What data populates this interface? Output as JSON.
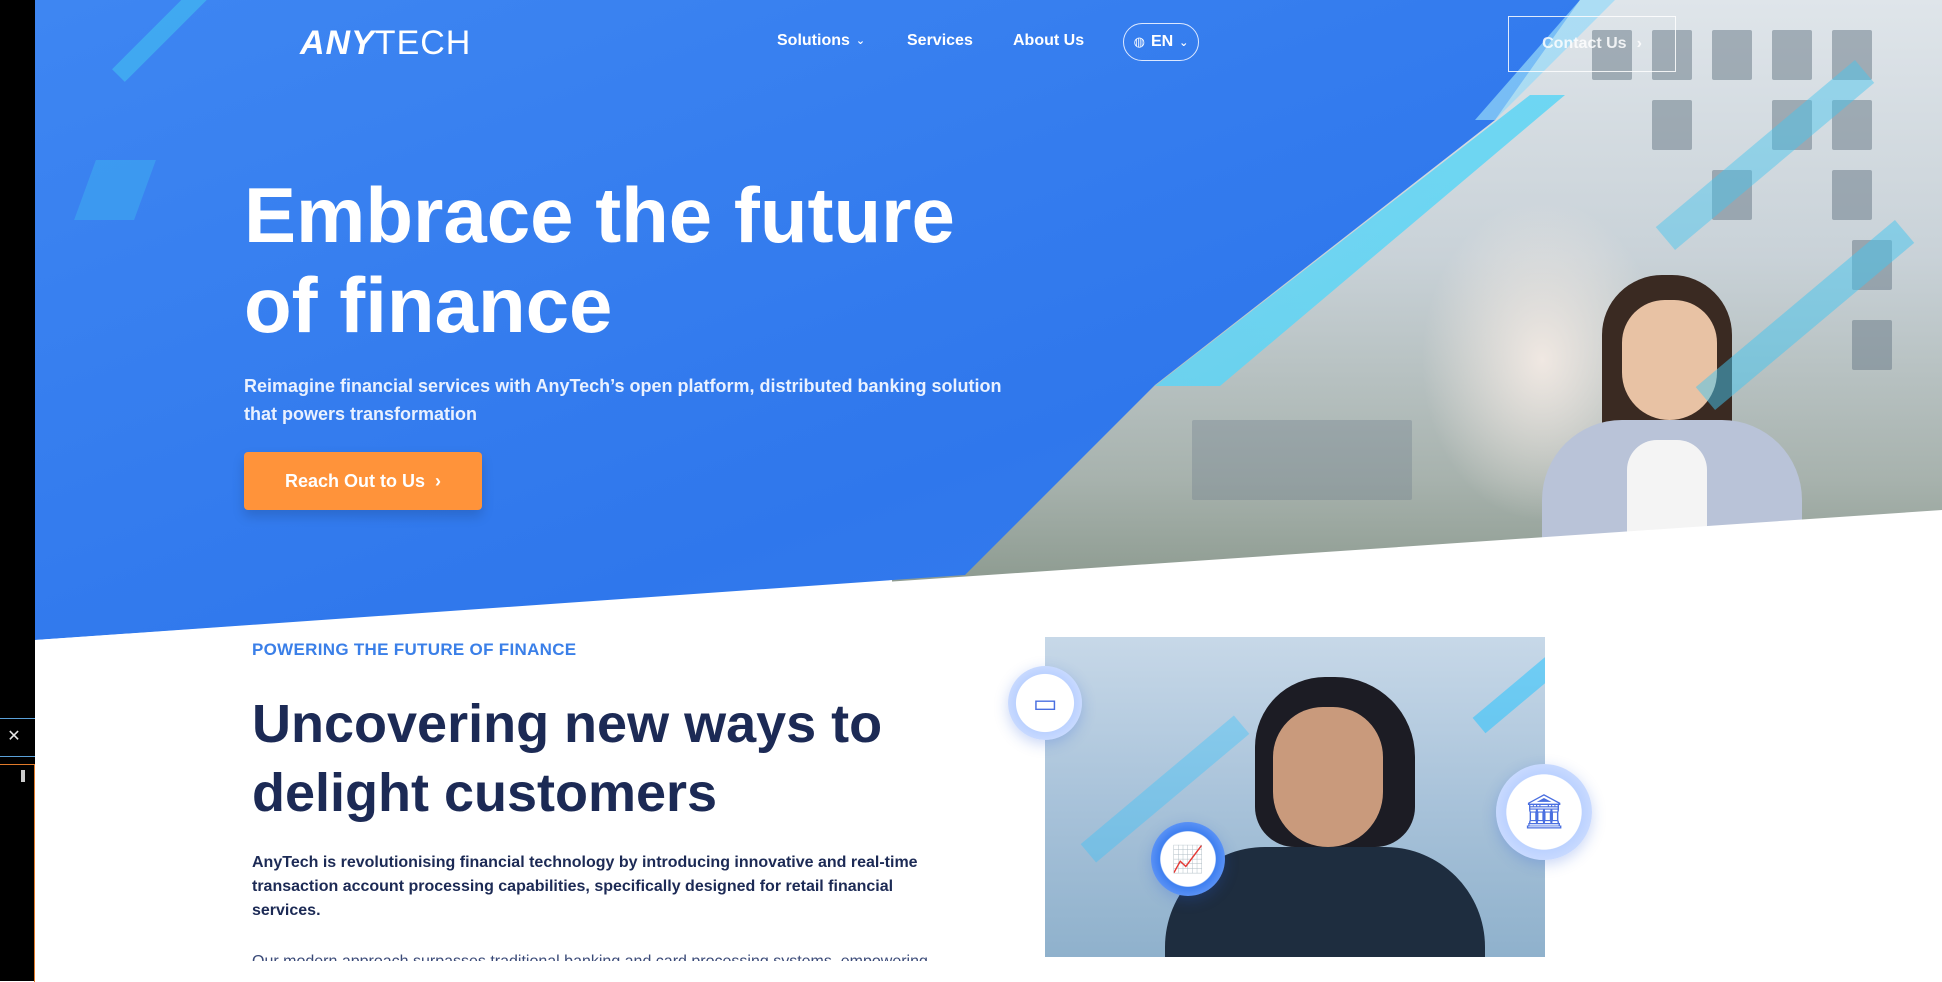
{
  "header": {
    "logo_text_bold": "ANY",
    "logo_text_light": "TECH",
    "nav": {
      "solutions": "Solutions",
      "services": "Services",
      "about": "About Us"
    },
    "language": "EN",
    "contact_button": "Contact Us"
  },
  "hero": {
    "title_line1": "Embrace the future",
    "title_line2": "of finance",
    "subtitle": "Reimagine financial services with AnyTech’s open platform, distributed banking solution that powers transformation",
    "cta_label": "Reach Out to Us"
  },
  "section": {
    "eyebrow": "POWERING THE FUTURE OF FINANCE",
    "title_line1": "Uncovering new ways to",
    "title_line2": "delight customers",
    "body": "AnyTech is revolutionising financial technology by introducing innovative and real-time transaction account processing capabilities, specifically designed for retail financial services.",
    "body2": "Our modern approach surpasses traditional banking and card processing systems, empowering"
  },
  "icons": {
    "globe": "globe-icon",
    "chevron": "chevron-down-icon",
    "arrow": "chevron-right-icon",
    "card": "card-icon",
    "chart": "bar-chart-icon",
    "bank": "bank-icon",
    "close": "close-icon"
  },
  "colors": {
    "hero_blue": "#3080ee",
    "cta_orange": "#ff933a",
    "heading_navy": "#1c2a55",
    "eyebrow_blue": "#3a7fe8"
  }
}
